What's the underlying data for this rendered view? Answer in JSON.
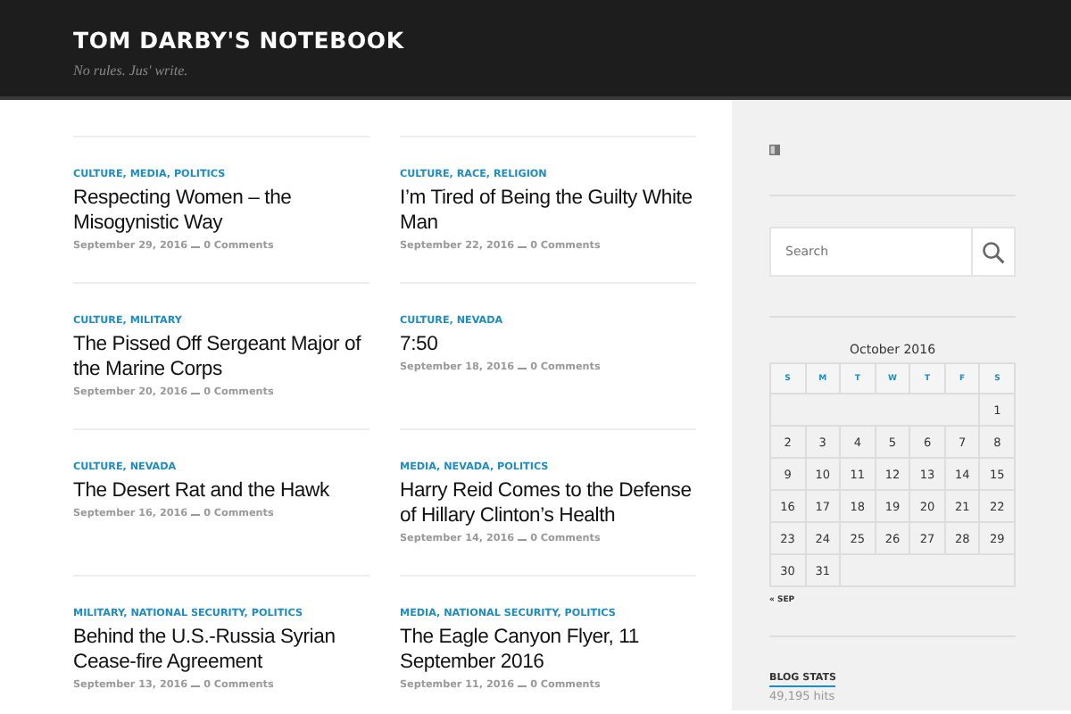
{
  "site": {
    "title": "TOM DARBY'S NOTEBOOK",
    "tagline": "No rules. Jus' write."
  },
  "posts": [
    {
      "categories": "CULTURE, MEDIA, POLITICS",
      "title": "Respecting Women – the Misogynistic Way",
      "date": "September 29, 2016",
      "comments": "0 Comments"
    },
    {
      "categories": "CULTURE, RACE, RELIGION",
      "title": "I’m Tired of Being the Guilty White Man",
      "date": "September 22, 2016",
      "comments": "0 Comments"
    },
    {
      "categories": "CULTURE, MILITARY",
      "title": "The Pissed Off Sergeant Major of the Marine Corps",
      "date": "September 20, 2016",
      "comments": "0 Comments"
    },
    {
      "categories": "CULTURE, NEVADA",
      "title": "7:50",
      "date": "September 18, 2016",
      "comments": "0 Comments"
    },
    {
      "categories": "CULTURE, NEVADA",
      "title": "The Desert Rat and the Hawk",
      "date": "September 16, 2016",
      "comments": "0 Comments"
    },
    {
      "categories": "MEDIA, NEVADA, POLITICS",
      "title": "Harry Reid Comes to the Defense of Hillary Clinton’s Health",
      "date": "September 14, 2016",
      "comments": "0 Comments"
    },
    {
      "categories": "MILITARY, NATIONAL SECURITY, POLITICS",
      "title": "Behind the U.S.-Russia Syrian Cease-fire Agreement",
      "date": "September 13, 2016",
      "comments": "0 Comments"
    },
    {
      "categories": "MEDIA, NATIONAL SECURITY, POLITICS",
      "title": "The Eagle Canyon Flyer, 11 September 2016",
      "date": "September 11, 2016",
      "comments": "0 Comments"
    }
  ],
  "search": {
    "placeholder": "Search"
  },
  "calendar": {
    "caption": "October 2016",
    "weekdays": [
      "S",
      "M",
      "T",
      "W",
      "T",
      "F",
      "S"
    ],
    "weeks": [
      {
        "days": [
          "1"
        ]
      },
      {
        "days": [
          "2",
          "3",
          "4",
          "5",
          "6",
          "7",
          "8"
        ]
      },
      {
        "days": [
          "9",
          "10",
          "11",
          "12",
          "13",
          "14",
          "15"
        ]
      },
      {
        "days": [
          "16",
          "17",
          "18",
          "19",
          "20",
          "21",
          "22"
        ]
      },
      {
        "days": [
          "23",
          "24",
          "25",
          "26",
          "27",
          "28",
          "29"
        ]
      },
      {
        "days": [
          "30",
          "31"
        ]
      }
    ],
    "prev_link": "« SEP"
  },
  "blog_stats": {
    "heading": "BLOG STATS",
    "hits": "49,195 hits"
  }
}
